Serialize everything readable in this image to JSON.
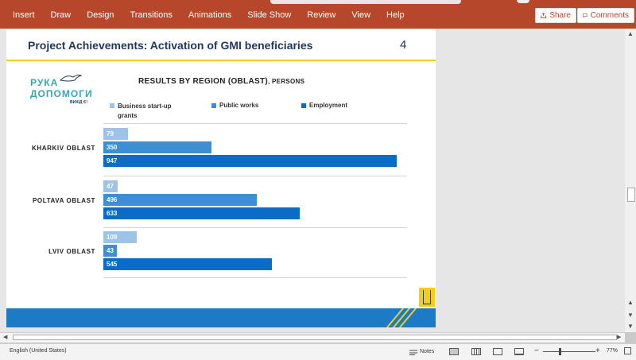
{
  "ribbon": {
    "tabs": [
      "Insert",
      "Draw",
      "Design",
      "Transitions",
      "Animations",
      "Slide Show",
      "Review",
      "View",
      "Help"
    ],
    "share_label": "Share",
    "comments_label": "Comments",
    "color": "#b7472a"
  },
  "slide": {
    "title": "Project Achievements: Activation of GMI beneficiaries",
    "number": "4",
    "logo": {
      "line1": "РУКА",
      "line2": "ДОПОМОГИ",
      "line3": "ВИХІД Є!"
    },
    "chart_title": "RESULTS BY REGION (OBLAST)",
    "chart_title_suffix": ", PERSONS"
  },
  "chart_data": {
    "type": "bar",
    "orientation": "horizontal",
    "title": "RESULTS BY REGION (OBLAST), PERSONS",
    "categories": [
      "KHARKIV OBLAST",
      "POLTAVA OBLAST",
      "LVIV OBLAST"
    ],
    "series": [
      {
        "name": "Business start-up grants",
        "color": "#9dc3e6",
        "values": [
          79,
          47,
          109
        ]
      },
      {
        "name": "Public works",
        "color": "#3d8fd1",
        "values": [
          350,
          496,
          43
        ]
      },
      {
        "name": "Employment",
        "color": "#0b6cc8",
        "values": [
          947,
          633,
          545
        ]
      }
    ],
    "xlim": [
      0,
      1000
    ],
    "grid": true,
    "legend_position": "top",
    "data_labels": true
  },
  "statusbar": {
    "language": "English (United States)",
    "notes_label": "Notes",
    "zoom": "77%"
  }
}
